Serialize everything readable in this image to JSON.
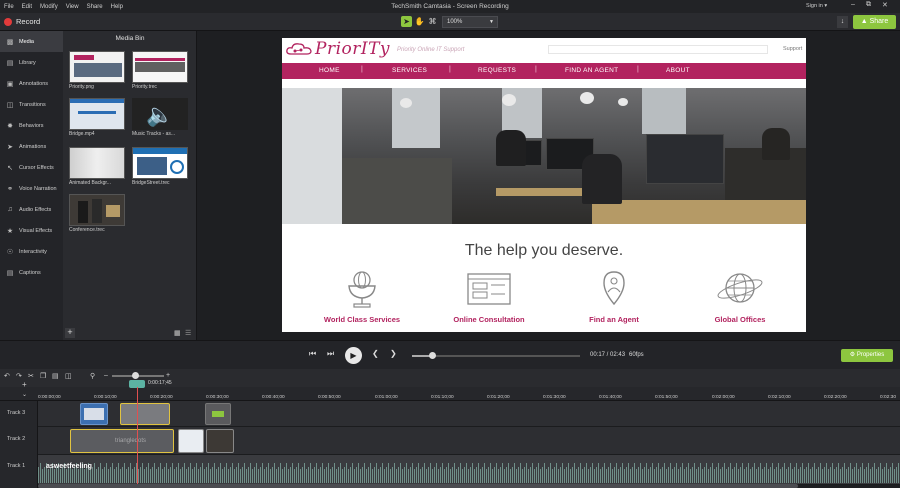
{
  "menu": [
    "File",
    "Edit",
    "Modify",
    "View",
    "Share",
    "Help"
  ],
  "app_title": "TechSmith Camtasia - Screen Recording",
  "sign_in": "Sign in ▾",
  "toolbar": {
    "record_label": "Record",
    "zoom": "100%",
    "share_label": "Share"
  },
  "sidebar": {
    "items": [
      {
        "label": "Media",
        "icon": "film-icon",
        "active": true
      },
      {
        "label": "Library",
        "icon": "library-icon"
      },
      {
        "label": "Annotations",
        "icon": "annotation-icon"
      },
      {
        "label": "Transitions",
        "icon": "transition-icon"
      },
      {
        "label": "Behaviors",
        "icon": "behavior-icon"
      },
      {
        "label": "Animations",
        "icon": "animation-icon"
      },
      {
        "label": "Cursor Effects",
        "icon": "cursor-icon"
      },
      {
        "label": "Voice Narration",
        "icon": "microphone-icon"
      },
      {
        "label": "Audio Effects",
        "icon": "audio-icon"
      },
      {
        "label": "Visual Effects",
        "icon": "visual-effects-icon"
      },
      {
        "label": "Interactivity",
        "icon": "interactivity-icon"
      },
      {
        "label": "Captions",
        "icon": "captions-icon"
      }
    ]
  },
  "media_bin": {
    "title": "Media Bin",
    "items": [
      {
        "label": "Priority.png"
      },
      {
        "label": "Priority.trec"
      },
      {
        "label": "Bridge.mp4"
      },
      {
        "label": "Music Tracks - as..."
      },
      {
        "label": "Animated Backgr..."
      },
      {
        "label": "BridgeStreet.trec"
      },
      {
        "label": "Conference.trec"
      }
    ]
  },
  "website": {
    "logo": "PriorITy",
    "tagline": "Priority Online IT Support",
    "support": "Support",
    "nav": [
      "HOME",
      "SERVICES",
      "REQUESTS",
      "FIND AN AGENT",
      "ABOUT"
    ],
    "heading": "The help you deserve.",
    "features": [
      "World Class Services",
      "Online Consultation",
      "Find an Agent",
      "Global Offices"
    ]
  },
  "playback": {
    "time": "00:17 / 02:43",
    "fps": "60fps",
    "progress": 0.11,
    "properties_label": "Properties"
  },
  "timeline": {
    "playhead_time": "0:00:17;45",
    "ticks": [
      "0:00:00;00",
      "0:00:10;00",
      "0:00:20;00",
      "0:00:30;00",
      "0:00:40;00",
      "0:00:50;00",
      "0:01:00;00",
      "0:01:10;00",
      "0:01:20;00",
      "0:01:30;00",
      "0:01:40;00",
      "0:01:50;00",
      "0:02:00;00",
      "0:02:10;00",
      "0:02:20;00",
      "0:02:30"
    ],
    "tracks": [
      "Track 3",
      "Track 2",
      "Track 1"
    ],
    "audio_clip": "asweetfeeling",
    "track2_clip": "triangledots"
  },
  "colors": {
    "accent": "#8dc63f",
    "brand": "#b2235f",
    "record": "#e23b3b"
  }
}
